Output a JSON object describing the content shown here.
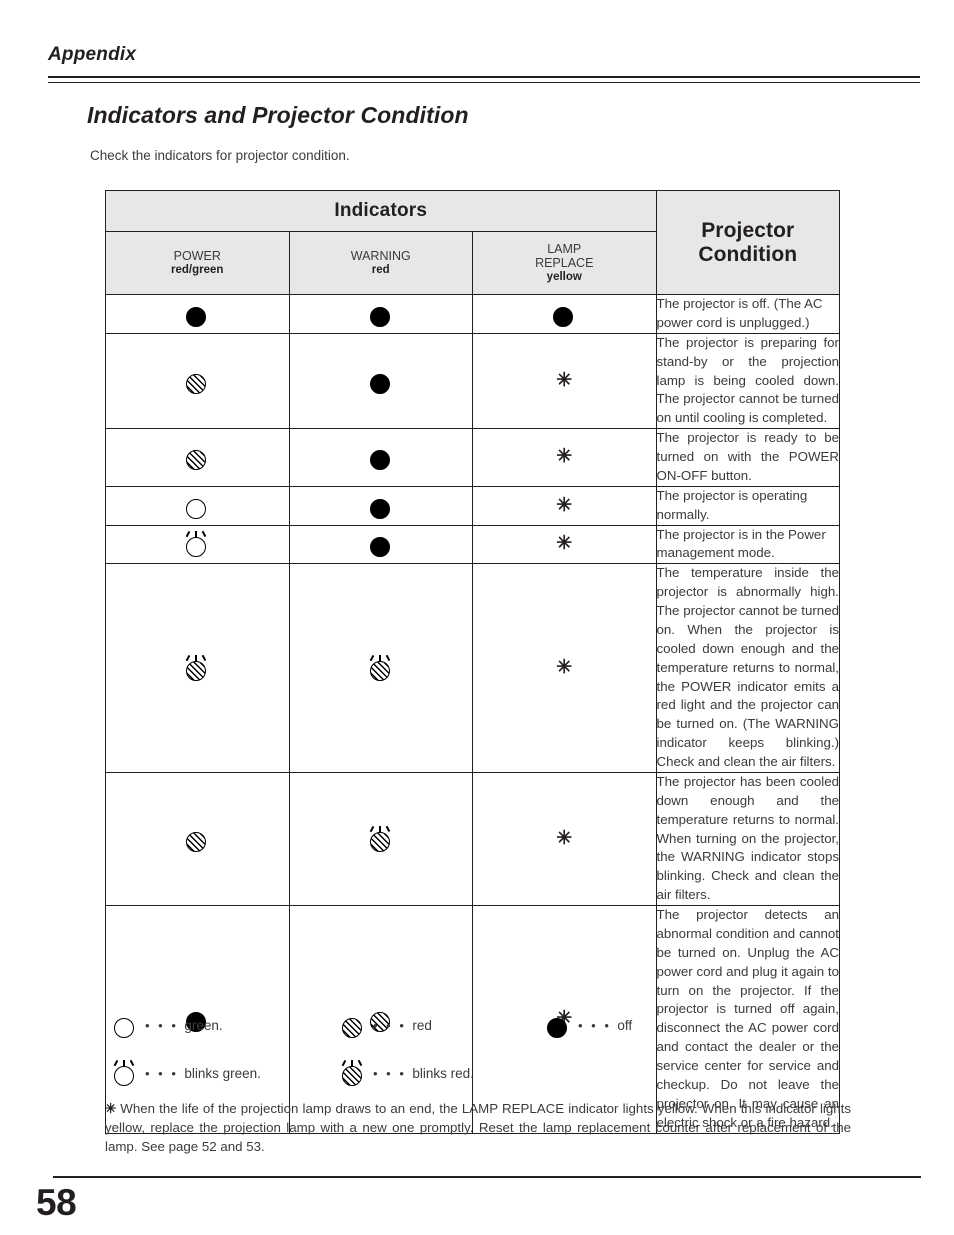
{
  "running_head": "Appendix",
  "section": {
    "title": "Indicators and Projector Condition",
    "intro": "Check the indicators for projector condition."
  },
  "table": {
    "group_header": "Indicators",
    "condition_header": "Projector Condition",
    "columns": [
      {
        "name": "POWER",
        "color": "red/green"
      },
      {
        "name": "WARNING",
        "color": "red"
      },
      {
        "name": "LAMP REPLACE",
        "name_line1": "LAMP",
        "name_line2": "REPLACE",
        "color": "yellow"
      }
    ],
    "rows": [
      {
        "power": "off",
        "warning": "off",
        "lamp": "off",
        "condition": "The projector is off.  (The AC power cord is unplugged.)",
        "justify": false
      },
      {
        "power": "red",
        "warning": "off",
        "lamp": "asterisk",
        "condition": "The projector is preparing for stand-by or the projection lamp is being cooled down.  The projector cannot be turned on until cooling is completed.",
        "justify": true
      },
      {
        "power": "red",
        "warning": "off",
        "lamp": "asterisk",
        "condition": "The projector is ready to be turned on with the POWER ON-OFF button.",
        "justify": true
      },
      {
        "power": "green",
        "warning": "off",
        "lamp": "asterisk",
        "condition": "The projector is operating normally.",
        "justify": false
      },
      {
        "power": "blinks-green",
        "warning": "off",
        "lamp": "asterisk",
        "condition": "The projector is in the Power management mode.",
        "justify": false
      },
      {
        "power": "blinks-red",
        "warning": "blinks-red",
        "lamp": "asterisk",
        "condition": "The temperature inside the projector is abnormally high.  The projector cannot be turned on.  When  the projector is cooled down enough and the temperature returns to normal, the POWER indicator emits a red light and the projector can be turned on.  (The WARNING indicator keeps blinking.)  Check and clean the air filters.",
        "justify": true
      },
      {
        "power": "red",
        "warning": "blinks-red",
        "lamp": "asterisk",
        "condition": "The projector has been cooled down enough and the temperature returns to normal.  When turning on the projector, the WARNING indicator stops blinking.  Check and clean the air filters.",
        "justify": true
      },
      {
        "power": "off",
        "warning": "red",
        "lamp": "asterisk",
        "condition": "The projector detects an abnormal condition and cannot be turned on.  Unplug the AC power cord and plug it again to turn on the projector.  If the projector is turned off again, disconnect the AC power cord and contact the dealer or the service center for service and checkup.  Do not leave the projector on.  It may cause an electric shock or a fire hazard.",
        "justify": true
      }
    ]
  },
  "legend": {
    "dots": "• • •",
    "items": [
      {
        "glyph": "green",
        "label": "green."
      },
      {
        "glyph": "red",
        "label": "red"
      },
      {
        "glyph": "off",
        "label": "off"
      },
      {
        "glyph": "blinks-green",
        "label": "blinks green."
      },
      {
        "glyph": "blinks-red",
        "label": "blinks red."
      }
    ]
  },
  "footnote": {
    "marker": "✳",
    "text": "When the life of the projection lamp draws to an end, the LAMP REPLACE indicator lights yellow. When this indicator lights yellow, replace the projection lamp with a new one promptly.  Reset the lamp replacement counter after replacement of the lamp.  See page 52 and 53."
  },
  "page_number": "58",
  "symbols": {
    "asterisk": "✳"
  }
}
